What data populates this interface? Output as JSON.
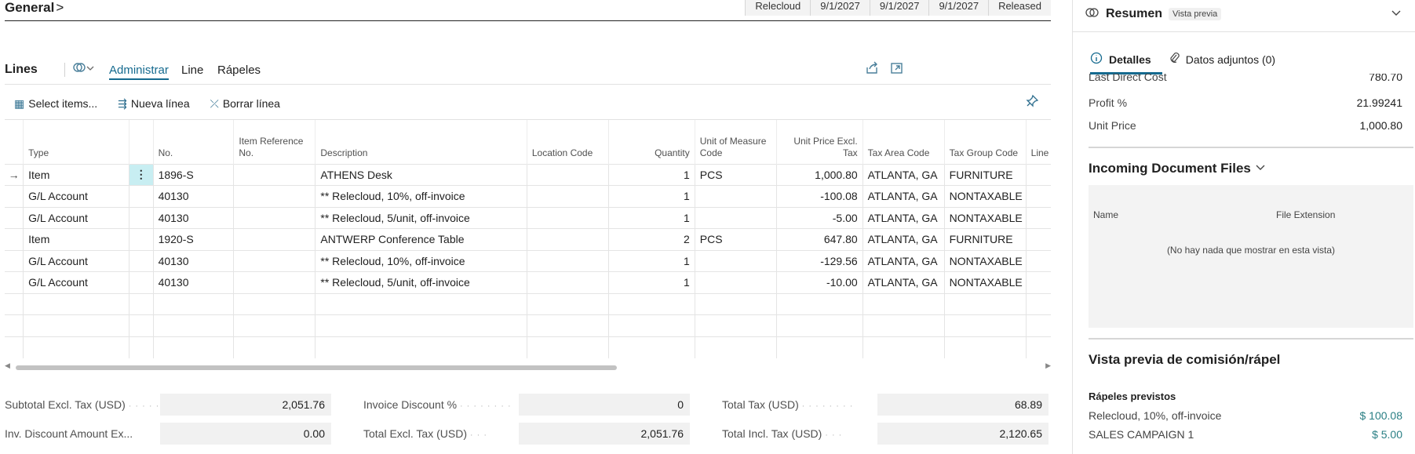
{
  "header": {
    "title": "General",
    "chevron": ">",
    "cells": [
      "Relecloud",
      "9/1/2027",
      "9/1/2027",
      "9/1/2027",
      "Released"
    ]
  },
  "lines": {
    "title": "Lines",
    "tabs": [
      "Administrar",
      "Line",
      "Rápeles"
    ],
    "actions": [
      {
        "icon": "select-items-icon",
        "label": "Select items..."
      },
      {
        "icon": "new-line-icon",
        "label": "Nueva línea"
      },
      {
        "icon": "delete-line-icon",
        "label": "Borrar línea"
      }
    ],
    "columns": [
      "Type",
      "No.",
      "Item Reference No.",
      "Description",
      "Location Code",
      "Quantity",
      "Unit of Measure Code",
      "Unit Price Excl. Tax",
      "Tax Area Code",
      "Tax Group Code",
      "Line Discou"
    ],
    "rows": [
      {
        "type": "Item",
        "no": "1896-S",
        "ref": "",
        "desc": "ATHENS Desk",
        "loc": "",
        "qty": "1",
        "uom": "PCS",
        "price": "1,000.80",
        "area": "ATLANTA, GA",
        "group": "FURNITURE"
      },
      {
        "type": "G/L Account",
        "no": "40130",
        "ref": "",
        "desc": "** Relecloud, 10%, off-invoice",
        "loc": "",
        "qty": "1",
        "uom": "",
        "price": "-100.08",
        "area": "ATLANTA, GA",
        "group": "NONTAXABLE"
      },
      {
        "type": "G/L Account",
        "no": "40130",
        "ref": "",
        "desc": "** Relecloud, 5/unit, off-invoice",
        "loc": "",
        "qty": "1",
        "uom": "",
        "price": "-5.00",
        "area": "ATLANTA, GA",
        "group": "NONTAXABLE"
      },
      {
        "type": "Item",
        "no": "1920-S",
        "ref": "",
        "desc": "ANTWERP Conference Table",
        "loc": "",
        "qty": "2",
        "uom": "PCS",
        "price": "647.80",
        "area": "ATLANTA, GA",
        "group": "FURNITURE"
      },
      {
        "type": "G/L Account",
        "no": "40130",
        "ref": "",
        "desc": "** Relecloud, 10%, off-invoice",
        "loc": "",
        "qty": "1",
        "uom": "",
        "price": "-129.56",
        "area": "ATLANTA, GA",
        "group": "NONTAXABLE"
      },
      {
        "type": "G/L Account",
        "no": "40130",
        "ref": "",
        "desc": "** Relecloud, 5/unit, off-invoice",
        "loc": "",
        "qty": "1",
        "uom": "",
        "price": "-10.00",
        "area": "ATLANTA, GA",
        "group": "NONTAXABLE"
      }
    ],
    "empty_rows": 3
  },
  "totals": [
    {
      "label": "Subtotal Excl. Tax (USD)",
      "value": "2,051.76"
    },
    {
      "label": "Inv. Discount Amount Ex...",
      "value": "0.00"
    },
    {
      "label": "Invoice Discount %",
      "value": "0"
    },
    {
      "label": "Total Excl. Tax (USD)",
      "value": "2,051.76"
    },
    {
      "label": "Total Tax (USD)",
      "value": "68.89"
    },
    {
      "label": "Total Incl. Tax (USD)",
      "value": "2,120.65"
    }
  ],
  "factbox": {
    "title": "Resumen",
    "badge": "Vista previa",
    "tabs": [
      {
        "icon": "info-icon",
        "label": "Detalles"
      },
      {
        "icon": "paperclip-icon",
        "label": "Datos adjuntos (0)"
      }
    ],
    "details": [
      {
        "label": "Last Direct Cost",
        "value": "780.70"
      },
      {
        "label": "Profit %",
        "value": "21.99241"
      },
      {
        "label": "Unit Price",
        "value": "1,000.80"
      }
    ],
    "incoming": {
      "title": "Incoming Document Files",
      "col_name": "Name",
      "col_ext": "File Extension",
      "empty": "(No hay nada que mostrar en esta vista)"
    },
    "commission": {
      "title": "Vista previa de comisión/rápel",
      "subtitle": "Rápeles previstos",
      "rows": [
        {
          "label": "Relecloud, 10%, off-invoice",
          "value": "$ 100.08"
        },
        {
          "label": "SALES CAMPAIGN 1",
          "value": "$ 5.00"
        }
      ]
    }
  }
}
